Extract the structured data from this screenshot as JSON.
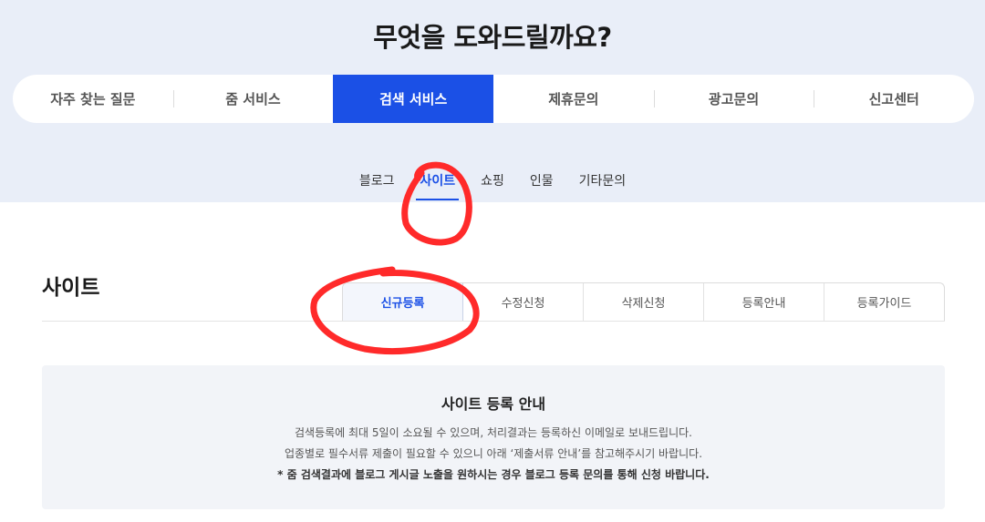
{
  "header": {
    "title": "무엇을 도와드릴까요?"
  },
  "main_tabs": [
    {
      "label": "자주 찾는 질문",
      "active": false
    },
    {
      "label": "줌 서비스",
      "active": false
    },
    {
      "label": "검색 서비스",
      "active": true
    },
    {
      "label": "제휴문의",
      "active": false
    },
    {
      "label": "광고문의",
      "active": false
    },
    {
      "label": "신고센터",
      "active": false
    }
  ],
  "sub_tabs": [
    {
      "label": "블로그",
      "active": false
    },
    {
      "label": "사이트",
      "active": true
    },
    {
      "label": "쇼핑",
      "active": false
    },
    {
      "label": "인물",
      "active": false
    },
    {
      "label": "기타문의",
      "active": false
    }
  ],
  "section": {
    "title": "사이트"
  },
  "reg_tabs": [
    {
      "label": "신규등록",
      "active": true
    },
    {
      "label": "수정신청",
      "active": false
    },
    {
      "label": "삭제신청",
      "active": false
    },
    {
      "label": "등록안내",
      "active": false
    },
    {
      "label": "등록가이드",
      "active": false
    }
  ],
  "info": {
    "title": "사이트 등록 안내",
    "line1": "검색등록에 최대 5일이 소요될 수 있으며, 처리결과는 등록하신 이메일로 보내드립니다.",
    "line2": "업종별로 필수서류 제출이 필요할 수 있으니 아래 ‘제출서류 안내’를 참고해주시기 바랍니다.",
    "line3": "* 줌 검색결과에 블로그 게시글 노출을 원하시는 경우 블로그 등록 문의를 통해 신청 바랍니다."
  },
  "colors": {
    "accent": "#1b50e6",
    "hero_bg": "#e9eef8",
    "annotation": "#ff2a2a"
  }
}
